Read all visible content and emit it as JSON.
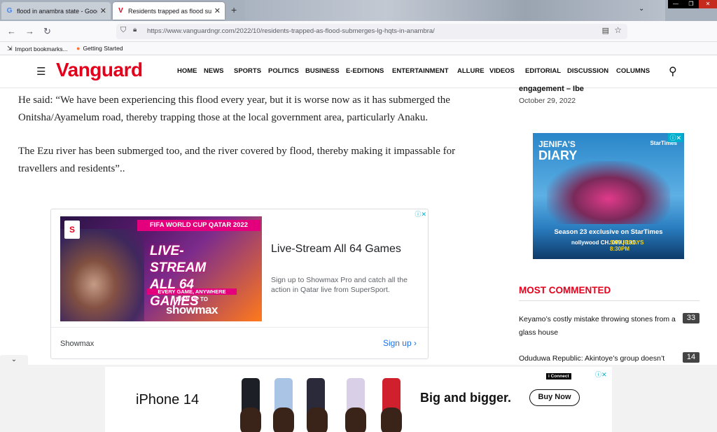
{
  "browser": {
    "tabs": [
      {
        "title": "flood in anambra state - Google",
        "favicon": "G"
      },
      {
        "title": "Residents trapped as flood subm",
        "favicon": "V"
      }
    ],
    "url": "https://www.vanguardngr.com/2022/10/residents-trapped-as-flood-submerges-lg-hqts-in-anambra/",
    "bookmarks": [
      {
        "label": "Import bookmarks..."
      },
      {
        "label": "Getting Started"
      }
    ]
  },
  "site": {
    "logo": "Vanguard",
    "nav": [
      "HOME",
      "NEWS",
      "SPORTS",
      "POLITICS",
      "BUSINESS",
      "E-EDITIONS",
      "ENTERTAINMENT",
      "ALLURE",
      "VIDEOS",
      "EDITORIAL",
      "DISCUSSION",
      "COLUMNS"
    ]
  },
  "article": {
    "p1": "He said: “We have been experiencing this flood every year, but it is worse now as it has submerged the Onitsha/Ayamelum road, thereby trapping those at the local government area, particularly Anaku.",
    "p2": "The Ezu river has been submerged too, and the river covered by flood, thereby making it impassable for travellers and residents”.."
  },
  "ad_showmax": {
    "band": "FIFA WORLD CUP QATAR 2022",
    "image_title": "LIVE-STREAM ALL 64 GAMES",
    "image_sub1": "EVERY GAME, ANYWHERE",
    "image_sub2": "SIGN UP TO",
    "image_brand": "showmax",
    "headline": "Live-Stream All 64 Games",
    "description": "Sign up to Showmax Pro and catch all the action in Qatar live from SuperSport.",
    "advertiser": "Showmax",
    "cta": "Sign up"
  },
  "sidebar": {
    "prev_title_end": "engagement – Ibe",
    "prev_date": "October 29, 2022",
    "ad_startimes": {
      "title_small": "JENIFA'S",
      "title_big": "DIARY",
      "brand": "StarTimes",
      "tagline": "Season 23 exclusive on StarTimes",
      "channel": "nollywood CH. 099 | 131",
      "schedule_day": "SATURDAYS",
      "schedule_time": "8:30PM"
    },
    "most_commented_title": "MOST COMMENTED",
    "most_commented": [
      {
        "title": "Keyamo’s costly mistake throwing stones from a glass house",
        "count": "33"
      },
      {
        "title": "Oduduwa Republic: Akintoye’s group doesn’t",
        "count": "14"
      }
    ]
  },
  "ad_iphone": {
    "product": "iPhone 14",
    "tagline": "Big and bigger.",
    "cta": "Buy Now",
    "partner": "i Connect"
  },
  "colors": {
    "brand_red": "#e4001b",
    "link_blue": "#1a73e8"
  }
}
